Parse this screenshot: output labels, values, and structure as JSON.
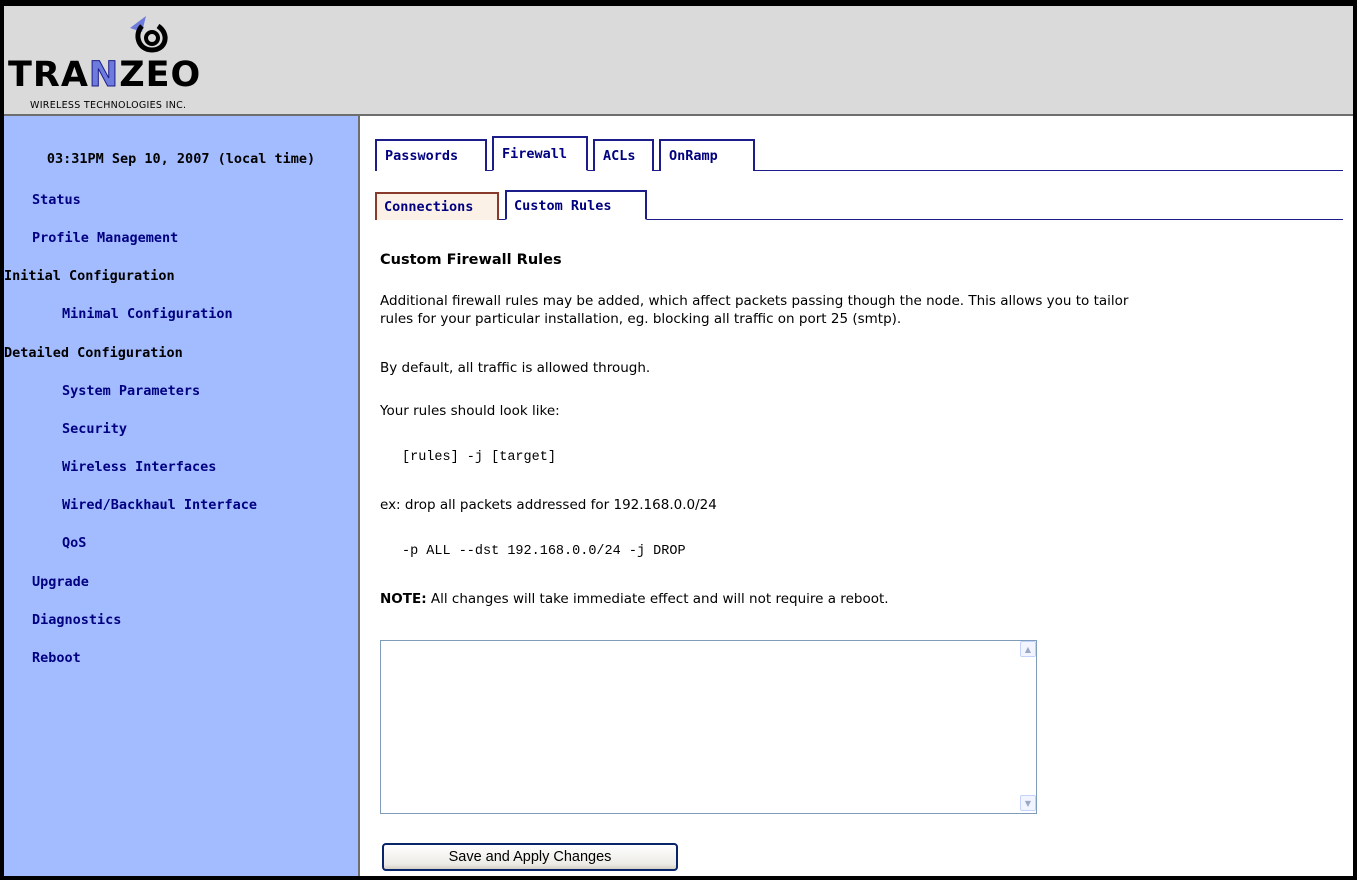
{
  "brand": {
    "name": "TRANZEO",
    "subtitle": "WIRELESS TECHNOLOGIES INC."
  },
  "sidebar": {
    "clock": "03:31PM Sep 10, 2007 (local time)",
    "items": [
      {
        "label": "Status"
      },
      {
        "label": "Profile Management"
      },
      {
        "label": "Initial Configuration"
      },
      {
        "label": "Minimal Configuration"
      },
      {
        "label": "Detailed Configuration"
      },
      {
        "label": "System Parameters"
      },
      {
        "label": "Security"
      },
      {
        "label": "Wireless Interfaces"
      },
      {
        "label": "Wired/Backhaul Interface"
      },
      {
        "label": "QoS"
      },
      {
        "label": "Upgrade"
      },
      {
        "label": "Diagnostics"
      },
      {
        "label": "Reboot"
      }
    ]
  },
  "tabs": [
    {
      "label": "Passwords"
    },
    {
      "label": "Firewall",
      "active": true
    },
    {
      "label": "ACLs"
    },
    {
      "label": "OnRamp"
    }
  ],
  "subtabs": [
    {
      "label": "Connections"
    },
    {
      "label": "Custom Rules",
      "active": true
    }
  ],
  "content": {
    "heading": "Custom Firewall Rules",
    "para1_line1": "Additional firewall rules may be added, which affect packets passing though the node. This allows you to tailor",
    "para1_line2": "rules for your particular installation, eg. blocking all traffic on port 25 (smtp).",
    "para2": "By default, all traffic is allowed through.",
    "para3": "Your rules should look like:",
    "code1": "[rules] -j [target]",
    "para4": "ex: drop all packets addressed for 192.168.0.0/24",
    "code2": "-p ALL --dst 192.168.0.0/24 -j DROP",
    "note_label": "NOTE:",
    "note_text": "All changes will take immediate effect and will not require a reboot.",
    "rules_value": "",
    "save_label": "Save and Apply Changes"
  },
  "colors": {
    "sidebar_bg": "#a3bcff",
    "header_bg": "#dadada",
    "nav_text": "#000080",
    "logo_accent": "#6d7bdc"
  }
}
